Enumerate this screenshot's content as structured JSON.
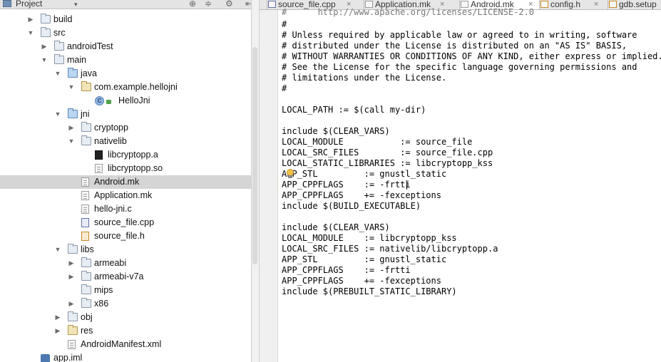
{
  "project_panel": {
    "title": "Project",
    "dropdown_arrow": "▾",
    "tools": [
      "⊕",
      "≑",
      "⚙",
      "⇤"
    ],
    "tree": [
      {
        "label": "build",
        "depth": 0,
        "arrow": "▶",
        "icon": "folder"
      },
      {
        "label": "src",
        "depth": 0,
        "arrow": "▼",
        "icon": "folder"
      },
      {
        "label": "androidTest",
        "depth": 1,
        "arrow": "▶",
        "icon": "folder"
      },
      {
        "label": "main",
        "depth": 1,
        "arrow": "▼",
        "icon": "folder"
      },
      {
        "label": "java",
        "depth": 2,
        "arrow": "▼",
        "icon": "folder-src"
      },
      {
        "label": "com.example.hellojni",
        "depth": 3,
        "arrow": "▼",
        "icon": "package-folder"
      },
      {
        "label": "HelloJni",
        "depth": 4,
        "arrow": "",
        "icon": "class"
      },
      {
        "label": "jni",
        "depth": 2,
        "arrow": "▼",
        "icon": "folder-src"
      },
      {
        "label": "cryptopp",
        "depth": 3,
        "arrow": "▶",
        "icon": "folder"
      },
      {
        "label": "nativelib",
        "depth": 3,
        "arrow": "▼",
        "icon": "folder"
      },
      {
        "label": "libcryptopp.a",
        "depth": 4,
        "arrow": "",
        "icon": "binary-file"
      },
      {
        "label": "libcryptopp.so",
        "depth": 4,
        "arrow": "",
        "icon": "file"
      },
      {
        "label": "Android.mk",
        "depth": 3,
        "arrow": "",
        "icon": "mk-file",
        "selected": true
      },
      {
        "label": "Application.mk",
        "depth": 3,
        "arrow": "",
        "icon": "mk-file"
      },
      {
        "label": "hello-jni.c",
        "depth": 3,
        "arrow": "",
        "icon": "file"
      },
      {
        "label": "source_file.cpp",
        "depth": 3,
        "arrow": "",
        "icon": "cpp-file"
      },
      {
        "label": "source_file.h",
        "depth": 3,
        "arrow": "",
        "icon": "h-file"
      },
      {
        "label": "libs",
        "depth": 2,
        "arrow": "▼",
        "icon": "folder"
      },
      {
        "label": "armeabi",
        "depth": 3,
        "arrow": "▶",
        "icon": "folder"
      },
      {
        "label": "armeabi-v7a",
        "depth": 3,
        "arrow": "▶",
        "icon": "folder"
      },
      {
        "label": "mips",
        "depth": 3,
        "arrow": "",
        "icon": "folder"
      },
      {
        "label": "x86",
        "depth": 3,
        "arrow": "▶",
        "icon": "folder"
      },
      {
        "label": "obj",
        "depth": 2,
        "arrow": "▶",
        "icon": "folder"
      },
      {
        "label": "res",
        "depth": 2,
        "arrow": "▶",
        "icon": "res-folder"
      },
      {
        "label": "AndroidManifest.xml",
        "depth": 2,
        "arrow": "",
        "icon": "xml-file"
      },
      {
        "label": "app.iml",
        "depth": 0,
        "arrow": "",
        "icon": "iml-file"
      }
    ]
  },
  "editor": {
    "tabs": [
      {
        "label": "source_file.cpp",
        "icon": "cpp-file",
        "active": false
      },
      {
        "label": "Application.mk",
        "icon": "mk-file",
        "active": false
      },
      {
        "label": "Android.mk",
        "icon": "mk-file",
        "active": true
      },
      {
        "label": "config.h",
        "icon": "h-file",
        "active": false
      },
      {
        "label": "gdb.setup",
        "icon": "h-file",
        "active": false
      }
    ],
    "close_glyph": "×",
    "partial_line": "#      http://www.apache.org/licenses/LICENSE-2.0",
    "lines": [
      "#",
      "# Unless required by applicable law or agreed to in writing, software",
      "# distributed under the License is distributed on an \"AS IS\" BASIS,",
      "# WITHOUT WARRANTIES OR CONDITIONS OF ANY KIND, either express or implied.",
      "# See the License for the specific language governing permissions and",
      "# limitations under the License.",
      "#",
      "",
      "LOCAL_PATH := $(call my-dir)",
      "",
      "include $(CLEAR_VARS)",
      "LOCAL_MODULE           := source_file",
      "LOCAL_SRC_FILES        := source_file.cpp",
      "LOCAL_STATIC_LIBRARIES := libcryptopp_kss",
      "APP_STL         := gnustl_static",
      "APP_CPPFLAGS    := -frtti",
      "APP_CPPFLAGS    += -fexceptions",
      "include $(BUILD_EXECUTABLE)",
      "",
      "include $(CLEAR_VARS)",
      "LOCAL_MODULE    := libcryptopp_kss",
      "LOCAL_SRC_FILES := nativelib/libcryptopp.a",
      "APP_STL         := gnustl_static",
      "APP_CPPFLAGS    := -frtti",
      "APP_CPPFLAGS    += -fexceptions",
      "include $(PREBUILT_STATIC_LIBRARY)"
    ]
  }
}
